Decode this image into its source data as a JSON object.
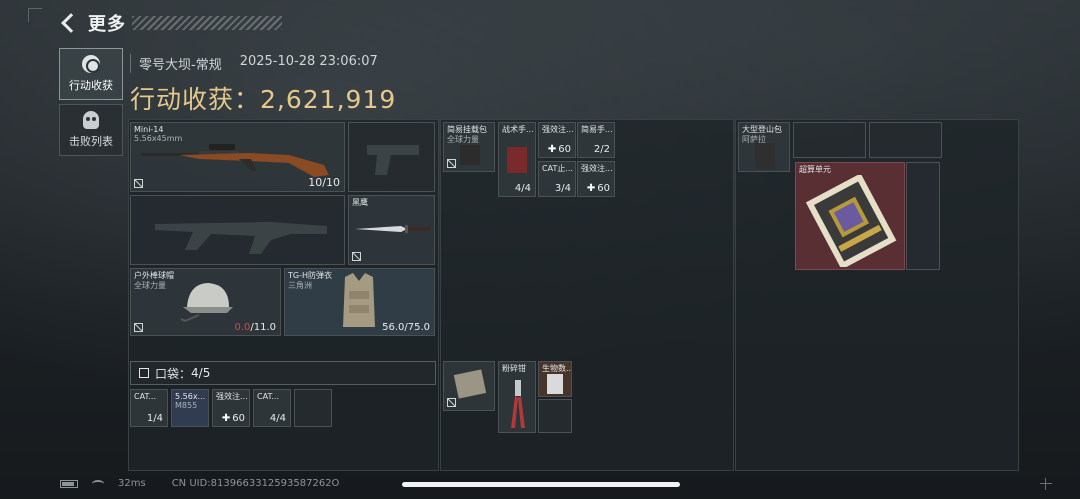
{
  "header": {
    "back_label": "更多"
  },
  "side_tabs": [
    {
      "label": "行动收获",
      "icon": "emblem-icon",
      "active": true
    },
    {
      "label": "击败列表",
      "icon": "skull-icon",
      "active": false
    }
  ],
  "meta": {
    "map": "零号大坝-常规",
    "datetime": "2025-10-28 23:06:07"
  },
  "loot": {
    "label": "行动收获：",
    "value": "2,621,919"
  },
  "equipment": {
    "primary": {
      "name": "Mini-14",
      "caliber": "5.56x45mm",
      "count": "10/10"
    },
    "knife": {
      "name": "黑鹰"
    },
    "helmet": {
      "name": "户外棒球帽",
      "sub": "全球力量",
      "durability_current": "0.0",
      "durability_max": "/11.0"
    },
    "armor": {
      "name": "TG-H防弹衣",
      "sub": "三角洲",
      "durability": "56.0/75.0"
    }
  },
  "pocket": {
    "label": "口袋：",
    "count": "4/5",
    "items": [
      {
        "name": "CAT...",
        "count": "1/4"
      },
      {
        "name": "5.56x...",
        "sub": "M855",
        "count": ""
      },
      {
        "name": "强效注...",
        "count": "60"
      },
      {
        "name": "CAT...",
        "count": "4/4"
      }
    ]
  },
  "rig": {
    "items": [
      {
        "name": "简易挂载包",
        "sub": "全球力量",
        "count": ""
      },
      {
        "name": "战术手...",
        "count": "4/4"
      },
      {
        "name": "强效注...",
        "count": "60"
      },
      {
        "name": "简易手...",
        "count": "2/2"
      },
      {
        "name": "CAT止...",
        "count": "3/4"
      },
      {
        "name": "强效注...",
        "count": "60"
      }
    ],
    "lower": [
      {
        "name": "",
        "count": ""
      },
      {
        "name": "粉碎钳",
        "count": ""
      },
      {
        "name": "生物数...",
        "count": ""
      }
    ]
  },
  "backpack": {
    "name": "大型登山包",
    "sub": "阿萨拉",
    "items": [
      {
        "name": "超算单元"
      }
    ]
  },
  "status": {
    "ping": "32ms",
    "uid": "CN UID:8139663312593587262O"
  },
  "colors": {
    "gold": "#e6c88a",
    "red": "#d04848",
    "rare_bg": "#5a2f33"
  }
}
